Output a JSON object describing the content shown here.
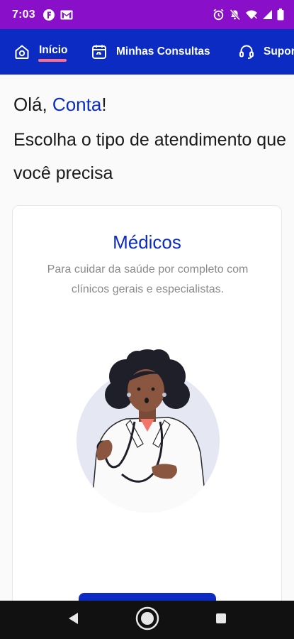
{
  "status_bar": {
    "time": "7:03",
    "left_icons": [
      "app-f-icon",
      "gmail-icon"
    ],
    "right_icons": [
      "alarm-icon",
      "mute-icon",
      "wifi-icon",
      "signal-icon",
      "battery-icon"
    ]
  },
  "nav": {
    "tabs": [
      {
        "label": "Início",
        "icon": "home-icon",
        "active": true
      },
      {
        "label": "Minhas Consultas",
        "icon": "consultas-icon",
        "active": false
      },
      {
        "label": "Suporte",
        "icon": "headset-icon",
        "active": false
      }
    ]
  },
  "greeting": {
    "prefix": "Olá, ",
    "name": "Conta",
    "suffix": "!"
  },
  "subtitle": "Escolha o tipo de atendimento que você precisa",
  "card": {
    "title": "Médicos",
    "description": "Para cuidar da saúde por completo com clínicos gerais e especialistas."
  },
  "colors": {
    "status_bar": "#8a0fc8",
    "primary": "#0b2bc2",
    "active_indicator": "#ff6f8a",
    "muted_text": "#8a8a8a"
  }
}
